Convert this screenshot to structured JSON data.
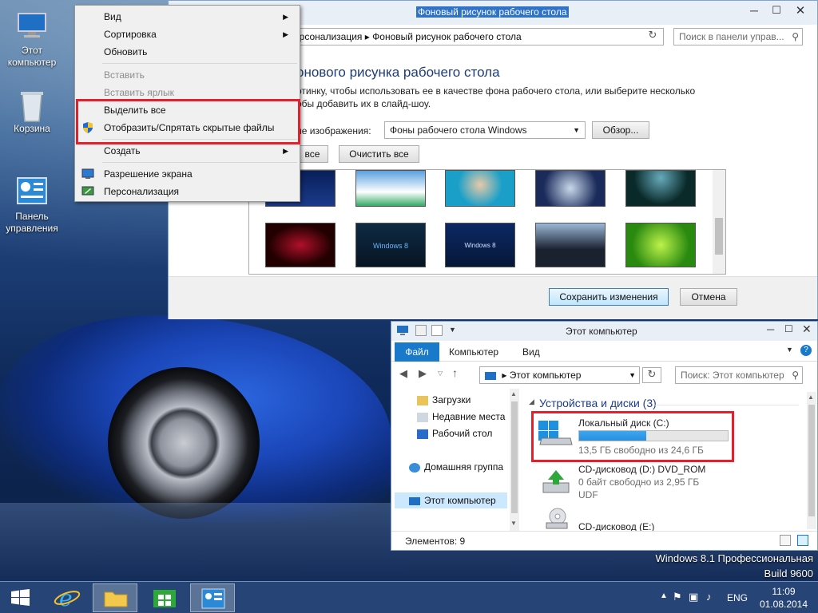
{
  "desktop": {
    "icons": [
      {
        "label_line1": "Этот",
        "label_line2": "компьютер"
      },
      {
        "label_line1": "Корзина",
        "label_line2": ""
      },
      {
        "label_line1": "Панель",
        "label_line2": "управления"
      }
    ],
    "watermark_line1": "Windows 8.1 Профессиональная",
    "watermark_line2": "Build 9600"
  },
  "context_menu": {
    "items": [
      {
        "label": "Вид",
        "submenu": true,
        "disabled": false
      },
      {
        "label": "Сортировка",
        "submenu": true,
        "disabled": false
      },
      {
        "label": "Обновить",
        "submenu": false,
        "disabled": false
      },
      {
        "label": "Вставить",
        "submenu": false,
        "disabled": true
      },
      {
        "label": "Вставить ярлык",
        "submenu": false,
        "disabled": true
      },
      {
        "label": "Выделить все",
        "submenu": false,
        "disabled": false
      },
      {
        "label": "Отобразить/Спрятать скрытые файлы",
        "submenu": false,
        "disabled": false
      },
      {
        "label": "Создать",
        "submenu": true,
        "disabled": false
      },
      {
        "label": "Разрешение экрана",
        "submenu": false,
        "disabled": false
      },
      {
        "label": "Персонализация",
        "submenu": false,
        "disabled": false
      }
    ],
    "submenu_glyph": "▶"
  },
  "bg_window": {
    "title": "Фоновый рисунок рабочего стола",
    "breadcrumb_part1": "ерсонализация",
    "breadcrumb_sep": "▸",
    "breadcrumb_part2": "Фоновый рисунок рабочего стола",
    "search_placeholder": "Поиск в панели управ...",
    "heading": "онового рисунка рабочего стола",
    "description_line1": "ртинку, чтобы использовать ее в качестве фона рабочего стола, или выберите несколько",
    "description_line2": "обы добавить их в слайд-шоу.",
    "location_label": "ие изображения:",
    "location_value": "Фоны рабочего стола Windows",
    "browse_label": "Обзор...",
    "select_all_label": "все",
    "clear_all_label": "Очистить все",
    "save_label": "Сохранить изменения",
    "cancel_label": "Отмена",
    "win8_thumb_text": "Windows 8",
    "win8_thumb_text2": "Windows 8"
  },
  "explorer": {
    "title": "Этот компьютер",
    "ribbon_tabs": [
      "Файл",
      "Компьютер",
      "Вид"
    ],
    "address": "Этот компьютер",
    "address_sep": "▸",
    "search_placeholder": "Поиск: Этот компьютер",
    "sidebar": [
      {
        "label": "Загрузки"
      },
      {
        "label": "Недавние места"
      },
      {
        "label": "Рабочий стол"
      },
      {
        "label": "Домашняя группа"
      },
      {
        "label": "Этот компьютер"
      }
    ],
    "section_title": "Устройства и диски (3)",
    "drives": [
      {
        "name": "Локальный диск (C:)",
        "detail": "13,5 ГБ свободно из 24,6 ГБ",
        "used_fraction": 0.45,
        "extra": ""
      },
      {
        "name": "CD-дисковод (D:) DVD_ROM",
        "detail": "0 байт свободно из 2,95 ГБ",
        "extra": "UDF"
      },
      {
        "name": "CD-дисковод (E:)",
        "detail": "",
        "extra": ""
      }
    ],
    "status": "Элементов: 9"
  },
  "taskbar": {
    "language": "ENG",
    "time": "11:09",
    "date": "01.08.2014"
  }
}
